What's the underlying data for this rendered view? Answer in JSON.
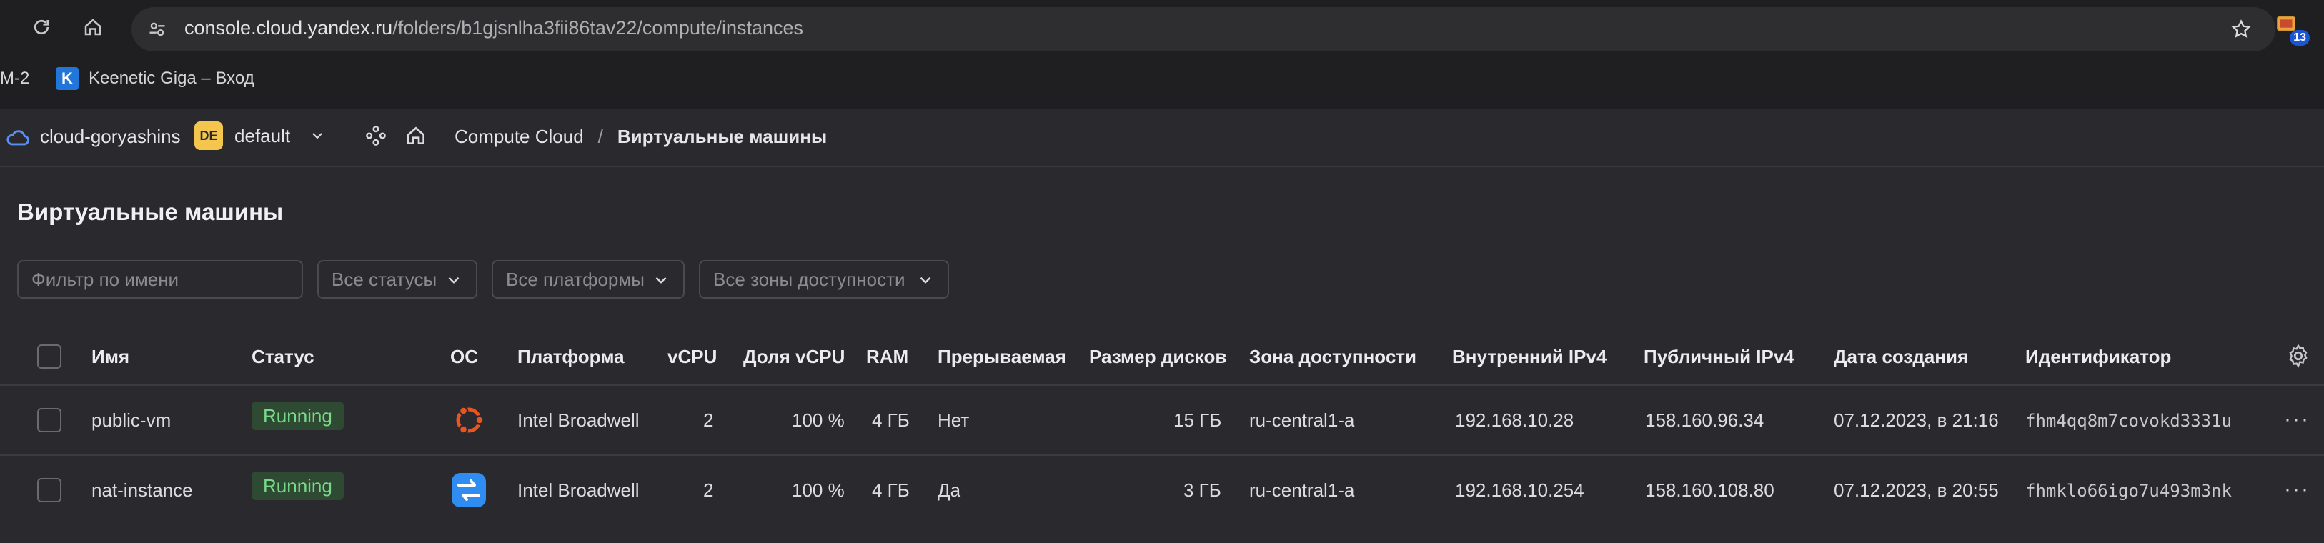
{
  "browser": {
    "url_host": "console.cloud.yandex.ru",
    "url_path": "/folders/b1gjsnlha3fii86tav22/compute/instances",
    "extension_badge": "13",
    "bookmarks": [
      {
        "label": "M-2"
      },
      {
        "label": "Keenetic Giga – Вход",
        "favicon": "K"
      }
    ]
  },
  "header": {
    "cloud_name": "cloud-goryashins",
    "folder_badge": "DE",
    "folder_name": "default",
    "breadcrumb_service": "Compute Cloud",
    "breadcrumb_separator": "/",
    "breadcrumb_current": "Виртуальные машины"
  },
  "page": {
    "title": "Виртуальные машины",
    "filters": {
      "name_placeholder": "Фильтр по имени",
      "status": "Все статусы",
      "platform": "Все платформы",
      "zone": "Все зоны доступности"
    }
  },
  "table": {
    "columns": {
      "name": "Имя",
      "status": "Статус",
      "os": "ОС",
      "platform": "Платформа",
      "vcpu": "vCPU",
      "vcpu_share": "Доля vCPU",
      "ram": "RAM",
      "preemptible": "Прерываемая",
      "disk_size": "Размер дисков",
      "zone": "Зона доступности",
      "internal_ip": "Внутренний IPv4",
      "public_ip": "Публичный IPv4",
      "created": "Дата создания",
      "id": "Идентификатор"
    },
    "rows": [
      {
        "name": "public-vm",
        "status": "Running",
        "os_icon": "ubuntu-icon",
        "platform": "Intel Broadwell",
        "vcpu": "2",
        "vcpu_share": "100 %",
        "ram": "4 ГБ",
        "preemptible": "Нет",
        "disk_size": "15 ГБ",
        "zone": "ru-central1-a",
        "internal_ip": "192.168.10.28",
        "public_ip": "158.160.96.34",
        "created": "07.12.2023, в 21:16",
        "id": "fhm4qq8m7covokd3331u"
      },
      {
        "name": "nat-instance",
        "status": "Running",
        "os_icon": "nat-instance-os-icon",
        "platform": "Intel Broadwell",
        "vcpu": "2",
        "vcpu_share": "100 %",
        "ram": "4 ГБ",
        "preemptible": "Да",
        "disk_size": "3 ГБ",
        "zone": "ru-central1-a",
        "internal_ip": "192.168.10.254",
        "public_ip": "158.160.108.80",
        "created": "07.12.2023, в 20:55",
        "id": "fhmklo66igo7u493m3nk"
      }
    ]
  },
  "colors": {
    "background": "#2a2a2e",
    "status_running_bg": "#2f4a33",
    "status_running_text": "#78d98a",
    "folder_badge": "#f5c64d",
    "ubuntu": "#e95420",
    "nat_icon": "#2f8cf0"
  }
}
